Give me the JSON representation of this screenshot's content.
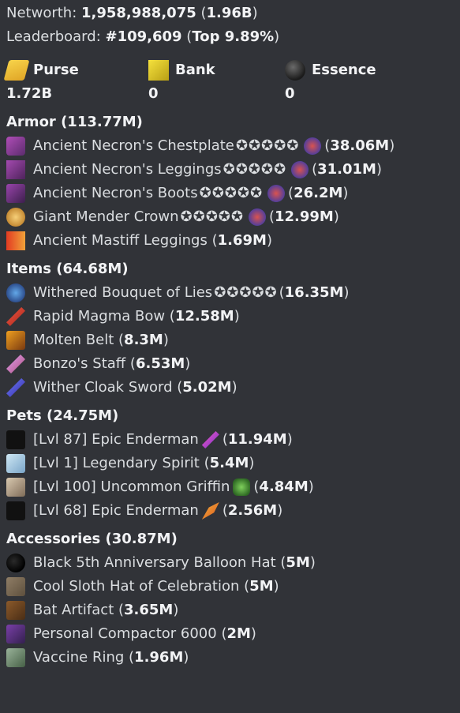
{
  "networth": {
    "label": "Networth: ",
    "value": "1,958,988,075",
    "short": "1.96B"
  },
  "leaderboard": {
    "label": "Leaderboard: ",
    "rank": "#109,609",
    "top": "Top 9.89%"
  },
  "currencies": [
    {
      "name": "Purse",
      "value": "1.72B",
      "icon": "gold-ingot-icon"
    },
    {
      "name": "Bank",
      "value": "0",
      "icon": "gold-block-icon"
    },
    {
      "name": "Essence",
      "value": "0",
      "icon": "wither-essence-icon"
    }
  ],
  "sections": [
    {
      "title": "Armor (113.77M)",
      "items": [
        {
          "name": "Ancient Necron's Chestplate",
          "stars": "✪✪✪✪✪",
          "value": "38.06M",
          "icon": "necron-chestplate-icon",
          "enchant": true
        },
        {
          "name": "Ancient Necron's Leggings",
          "stars": "✪✪✪✪✪",
          "value": "31.01M",
          "icon": "necron-leggings-icon",
          "enchant": true
        },
        {
          "name": "Ancient Necron's Boots",
          "stars": "✪✪✪✪✪",
          "value": "26.2M",
          "icon": "necron-boots-icon",
          "enchant": true
        },
        {
          "name": "Giant Mender Crown",
          "stars": "✪✪✪✪✪",
          "value": "12.99M",
          "icon": "mender-crown-icon",
          "enchant": true
        },
        {
          "name": "Ancient Mastiff Leggings",
          "stars": "",
          "value": "1.69M",
          "icon": "mastiff-leggings-icon",
          "enchant": false
        }
      ]
    },
    {
      "title": "Items (64.68M)",
      "items": [
        {
          "name": "Withered Bouquet of Lies",
          "stars": "✪✪✪✪✪",
          "value": "16.35M",
          "icon": "bouquet-icon",
          "enchant": false
        },
        {
          "name": "Rapid Magma Bow",
          "stars": "",
          "value": "12.58M",
          "icon": "magma-bow-icon",
          "enchant": false
        },
        {
          "name": "Molten Belt",
          "stars": "",
          "value": "8.3M",
          "icon": "molten-belt-icon",
          "enchant": false
        },
        {
          "name": "Bonzo's Staff",
          "stars": "",
          "value": "6.53M",
          "icon": "bonzo-staff-icon",
          "enchant": false
        },
        {
          "name": "Wither Cloak Sword",
          "stars": "",
          "value": "5.02M",
          "icon": "wither-cloak-sword-icon",
          "enchant": false
        }
      ]
    },
    {
      "title": "Pets (24.75M)",
      "items": [
        {
          "name": "[Lvl 87] Epic Enderman",
          "value": "11.94M",
          "icon": "enderman-pet-icon",
          "pet_item": "pink-sword-item-icon"
        },
        {
          "name": "[Lvl 1] Legendary Spirit",
          "value": "5.4M",
          "icon": "spirit-pet-icon",
          "pet_item": ""
        },
        {
          "name": "[Lvl 100] Uncommon Griffin",
          "value": "4.84M",
          "icon": "griffin-pet-icon",
          "pet_item": "green-gem-item-icon"
        },
        {
          "name": "[Lvl 68] Epic Enderman",
          "value": "2.56M",
          "icon": "enderman-pet-icon",
          "pet_item": "carrot-item-icon"
        }
      ]
    },
    {
      "title": "Accessories (30.87M)",
      "items": [
        {
          "name": "Black 5th Anniversary Balloon Hat",
          "value": "5M",
          "icon": "balloon-hat-icon"
        },
        {
          "name": "Cool Sloth Hat of Celebration",
          "value": "5M",
          "icon": "sloth-hat-icon"
        },
        {
          "name": "Bat Artifact",
          "value": "3.65M",
          "icon": "bat-artifact-icon"
        },
        {
          "name": "Personal Compactor 6000",
          "value": "2M",
          "icon": "compactor-icon"
        },
        {
          "name": "Vaccine Ring",
          "value": "1.96M",
          "icon": "vaccine-ring-icon"
        }
      ]
    }
  ]
}
